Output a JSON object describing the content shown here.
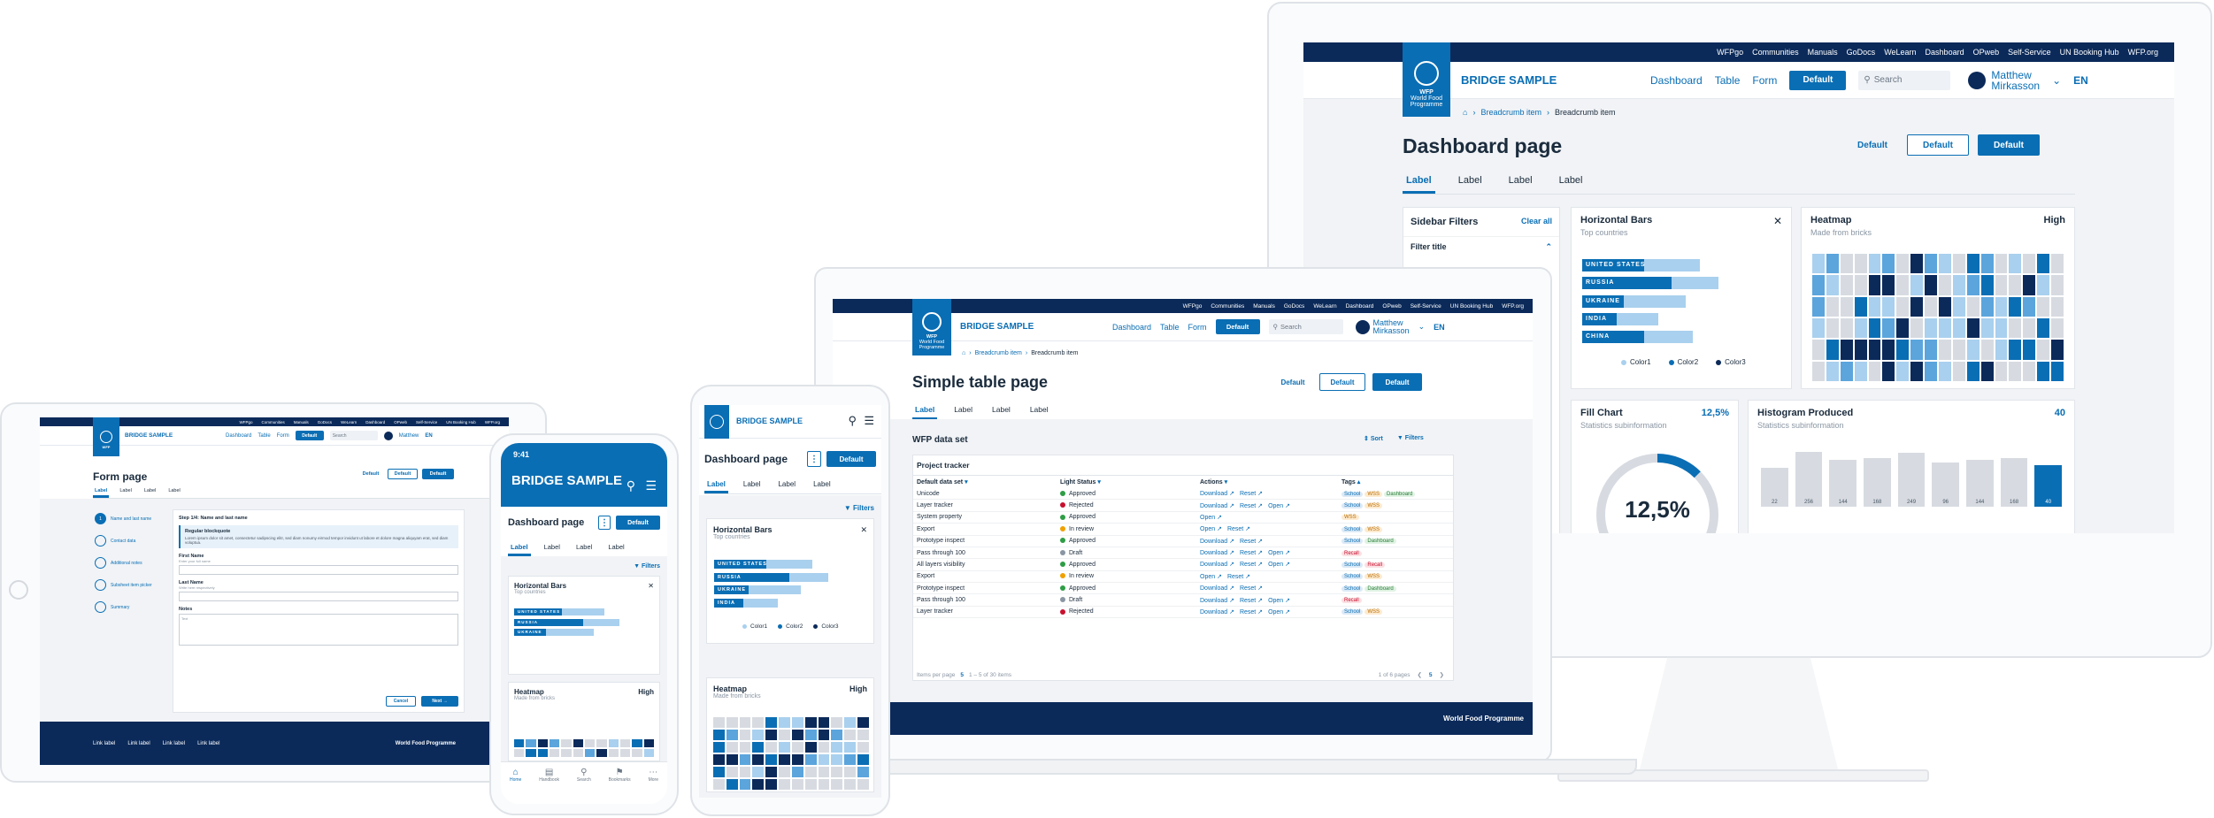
{
  "common": {
    "brand": "BRIDGE SAMPLE",
    "logo_text": "WFP",
    "logo_org": "World Food Programme",
    "footer_org": "World Food Programme",
    "topnav": [
      "WFPgo",
      "Communities",
      "Manuals",
      "GoDocs",
      "WeLearn",
      "Dashboard",
      "OPweb",
      "Self-Service",
      "UN Booking Hub",
      "WFP.org"
    ],
    "mainnav": [
      "Dashboard",
      "Table",
      "Form"
    ],
    "btn_default": "Default",
    "search_placeholder": "Search",
    "user_first": "Matthew",
    "user_last": "Mirkasson",
    "lang": "EN",
    "breadcrumb": [
      "Breadcrumb item",
      "Breadcrumb item"
    ],
    "tabs": [
      "Label",
      "Label",
      "Label",
      "Label"
    ],
    "footer_links": [
      "Link label",
      "Link label",
      "Link label",
      "Link label"
    ]
  },
  "desktop": {
    "page_title": "Dashboard page",
    "sidebar_title": "Sidebar Filters",
    "clear_all": "Clear all",
    "filter_title": "Filter title",
    "hbars": {
      "title": "Horizontal Bars",
      "sub": "Top countries",
      "rows": [
        {
          "label": "UNITED STATES",
          "value": 0.45,
          "bg": 0.85
        },
        {
          "label": "RUSSIA",
          "value": 0.65,
          "bg": 0.99
        },
        {
          "label": "UKRAINE",
          "value": 0.3,
          "bg": 0.75
        },
        {
          "label": "INDIA",
          "value": 0.25,
          "bg": 0.55
        },
        {
          "label": "CHINA",
          "value": 0.45,
          "bg": 0.8
        }
      ],
      "legend": [
        "Color1",
        "Color2",
        "Color3"
      ]
    },
    "heatmap": {
      "title": "Heatmap",
      "sub": "Made from bricks",
      "level": "High"
    },
    "fill": {
      "title": "Fill Chart",
      "sub": "Statistics subinformation",
      "value": "12,5%",
      "pct": 12.5
    },
    "hist": {
      "title": "Histogram Produced",
      "sub": "Statistics subinformation",
      "count": "40",
      "values": [
        22,
        256,
        144,
        168,
        249,
        96,
        144,
        168,
        40
      ]
    }
  },
  "laptop": {
    "page_title": "Simple table page",
    "dataset": "WFP data set",
    "sort": "Sort",
    "filters": "Filters",
    "table_title": "Project tracker",
    "cols": [
      "Default data set",
      "Light Status",
      "Actions",
      "Tags"
    ],
    "rows": [
      {
        "name": "Unicode",
        "status": "Approved",
        "color": "#2e9d46",
        "actions": [
          "Download",
          "Reset"
        ],
        "tags": [
          "School",
          "WSS",
          "Dashboard"
        ]
      },
      {
        "name": "Layer tracker",
        "status": "Rejected",
        "color": "#c8102e",
        "actions": [
          "Download",
          "Reset",
          "Open"
        ],
        "tags": [
          "School",
          "WSS"
        ]
      },
      {
        "name": "System property",
        "status": "Approved",
        "color": "#2e9d46",
        "actions": [
          "Open"
        ],
        "tags": [
          "WSS"
        ]
      },
      {
        "name": "Export",
        "status": "In review",
        "color": "#f0a000",
        "actions": [
          "Open",
          "Reset"
        ],
        "tags": [
          "School",
          "WSS"
        ]
      },
      {
        "name": "Prototype inspect",
        "status": "Approved",
        "color": "#2e9d46",
        "actions": [
          "Download",
          "Reset"
        ],
        "tags": [
          "School",
          "Dashboard"
        ]
      },
      {
        "name": "Pass through 100",
        "status": "Draft",
        "color": "#8a96a3",
        "actions": [
          "Download",
          "Reset",
          "Open"
        ],
        "tags": [
          "Recall"
        ]
      },
      {
        "name": "All layers visibility",
        "status": "Approved",
        "color": "#2e9d46",
        "actions": [
          "Download",
          "Reset",
          "Open"
        ],
        "tags": [
          "School",
          "Recall"
        ]
      },
      {
        "name": "Export",
        "status": "In review",
        "color": "#f0a000",
        "actions": [
          "Open",
          "Reset"
        ],
        "tags": [
          "School",
          "WSS"
        ]
      },
      {
        "name": "Prototype inspect",
        "status": "Approved",
        "color": "#2e9d46",
        "actions": [
          "Download",
          "Reset"
        ],
        "tags": [
          "School",
          "Dashboard"
        ]
      },
      {
        "name": "Pass through 100",
        "status": "Draft",
        "color": "#8a96a3",
        "actions": [
          "Download",
          "Reset",
          "Open"
        ],
        "tags": [
          "Recall"
        ]
      },
      {
        "name": "Layer tracker",
        "status": "Rejected",
        "color": "#c8102e",
        "actions": [
          "Download",
          "Reset",
          "Open"
        ],
        "tags": [
          "School",
          "WSS"
        ]
      }
    ],
    "per_page_label": "Items per page",
    "per_page": "5",
    "range": "1 – 5 of 30 items",
    "pages": "1 of 6 pages",
    "page_sel": "5"
  },
  "tablet": {
    "page_title": "Form page",
    "steps": [
      "Name and last name",
      "Contact data",
      "Additional notes",
      "Subsheet item picker",
      "Summary"
    ],
    "step_heading": "Step 1/4: Name and last name",
    "quote_title": "Regular blockquote",
    "quote_text": "Lorem ipsum dolor sit amet, consectetur sadipscing elitr, sed diam nonumy eirmod tempor invidunt ut labore et dolore magna aliquyam erat, sed diam voluptua.",
    "first_name": "First Name",
    "first_hint": "Enter your full name",
    "last_name": "Last Name",
    "last_hint": "Write here respectively",
    "notes": "Notes",
    "notes_ph": "Text",
    "cancel": "Cancel",
    "next": "Next"
  },
  "phone1": {
    "time": "9:41",
    "page_title": "Dashboard page",
    "bottom_nav": [
      "Home",
      "Handbook",
      "Search",
      "Bookmarks",
      "More"
    ]
  },
  "phone2": {
    "page_title": "Dashboard page"
  }
}
